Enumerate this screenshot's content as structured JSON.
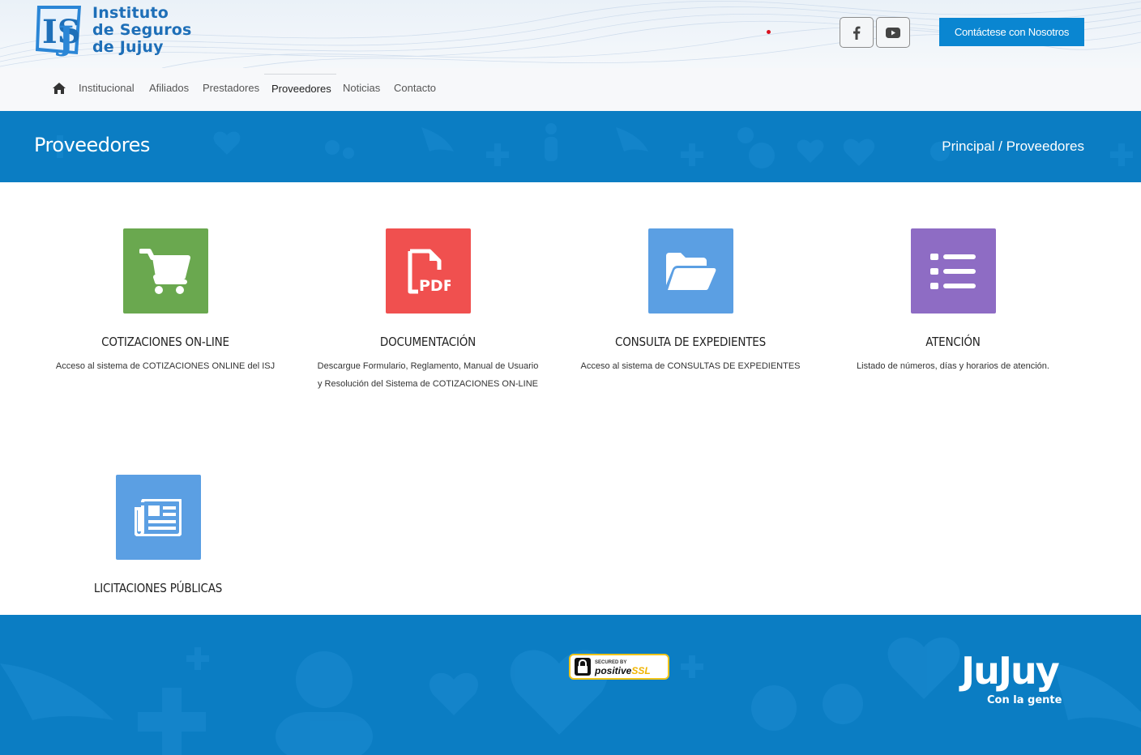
{
  "header": {
    "logo_lines": [
      "Instituto",
      "de Seguros",
      "de Jujuy"
    ],
    "logo_mark": "ISJ",
    "contact_button": "Contáctese con Nosotros",
    "social": [
      "facebook-icon",
      "youtube-icon"
    ]
  },
  "nav": {
    "items": [
      {
        "label": "Institucional"
      },
      {
        "label": "Afiliados"
      },
      {
        "label": "Prestadores"
      },
      {
        "label": "Proveedores",
        "active": true
      },
      {
        "label": "Noticias"
      },
      {
        "label": "Contacto"
      }
    ]
  },
  "banner": {
    "title": "Proveedores",
    "breadcrumb": "Principal / Proveedores"
  },
  "cards": [
    {
      "title": "COTIZACIONES ON-LINE",
      "desc": "Acceso al sistema de COTIZACIONES ONLINE del ISJ",
      "icon": "cart-icon",
      "color": "#6aa84f"
    },
    {
      "title": "DOCUMENTACIÓN",
      "desc": "Descargue Formulario, Reglamento, Manual de Usuario y Resolución del Sistema de COTIZACIONES ON-LINE",
      "icon": "pdf-icon",
      "color": "#f0504f"
    },
    {
      "title": "CONSULTA DE EXPEDIENTES",
      "desc": "Acceso al sistema de CONSULTAS DE EXPEDIENTES",
      "icon": "folder-open-icon",
      "color": "#5b9fe3"
    },
    {
      "title": "ATENCIÓN",
      "desc": "Listado de números, días y horarios de atención.",
      "icon": "list-icon",
      "color": "#8e6cc4"
    },
    {
      "title": "LICITACIONES PÚBLICAS",
      "desc": "",
      "icon": "newspaper-icon",
      "color": "#5b9fe3"
    }
  ],
  "footer": {
    "ssl_small": "SECURED BY",
    "ssl_brand": "positive",
    "ssl_suffix": "SSL",
    "jujuy_word": "JuJuy",
    "jujuy_tagline": "Con la gente"
  },
  "colors": {
    "primary_blue": "#0b7dc3",
    "button_blue": "#0a86d1"
  }
}
